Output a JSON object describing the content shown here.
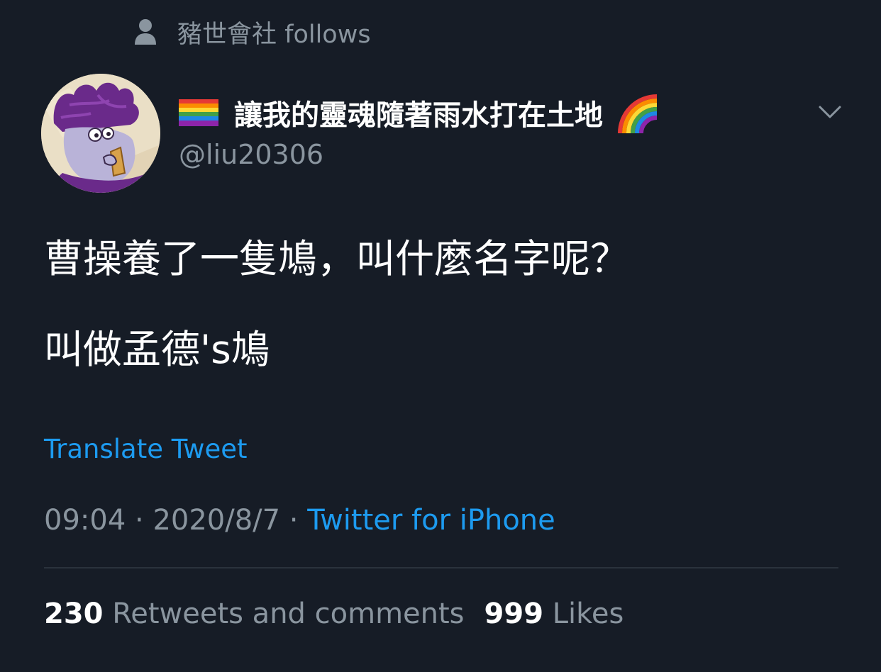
{
  "social_context": {
    "text": "豬世會社 follows",
    "icon": "person-icon"
  },
  "author": {
    "display_name": "讓我的靈魂隨著雨水打在土地",
    "handle": "@liu20306",
    "flag_icon": "rainbow-flag-icon",
    "trailing_icon": "rainbow-icon"
  },
  "tweet": {
    "lines": [
      "曹操養了一隻鳩，叫什麼名字呢？",
      "叫做孟德's鳩"
    ],
    "translate_label": "Translate Tweet"
  },
  "meta": {
    "time": "09:04",
    "separator": " · ",
    "date": "2020/8/7",
    "source": "Twitter for iPhone"
  },
  "stats": {
    "retweets_count": "230",
    "retweets_label": " Retweets and comments",
    "likes_count": "999",
    "likes_label": " Likes"
  },
  "colors": {
    "background": "#161c26",
    "secondary_text": "#8a959f",
    "link": "#1d9bf0"
  }
}
